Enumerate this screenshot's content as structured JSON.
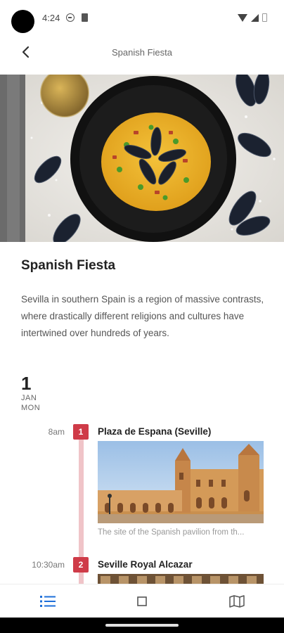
{
  "status": {
    "time": "4:24"
  },
  "app_bar": {
    "title": "Spanish Fiesta"
  },
  "event": {
    "title": "Spanish Fiesta",
    "description": "Sevilla in southern Spain is a region of massive contrasts, where drastically different religions and cultures have intertwined over hundreds of years."
  },
  "day": {
    "number": "1",
    "month": "JAN",
    "weekday": "MON"
  },
  "stops": [
    {
      "time": "8am",
      "index": "1",
      "title": "Plaza de Espana (Seville)",
      "caption": "The site of the Spanish pavilion from th..."
    },
    {
      "time": "10:30am",
      "index": "2",
      "title": "Seville Royal Alcazar"
    }
  ],
  "colors": {
    "accent": "#cf3b48",
    "timeline": "#f0c4c8",
    "nav_active": "#1e6fd9"
  },
  "bottom_nav": [
    "list-icon",
    "square-icon",
    "map-icon"
  ]
}
